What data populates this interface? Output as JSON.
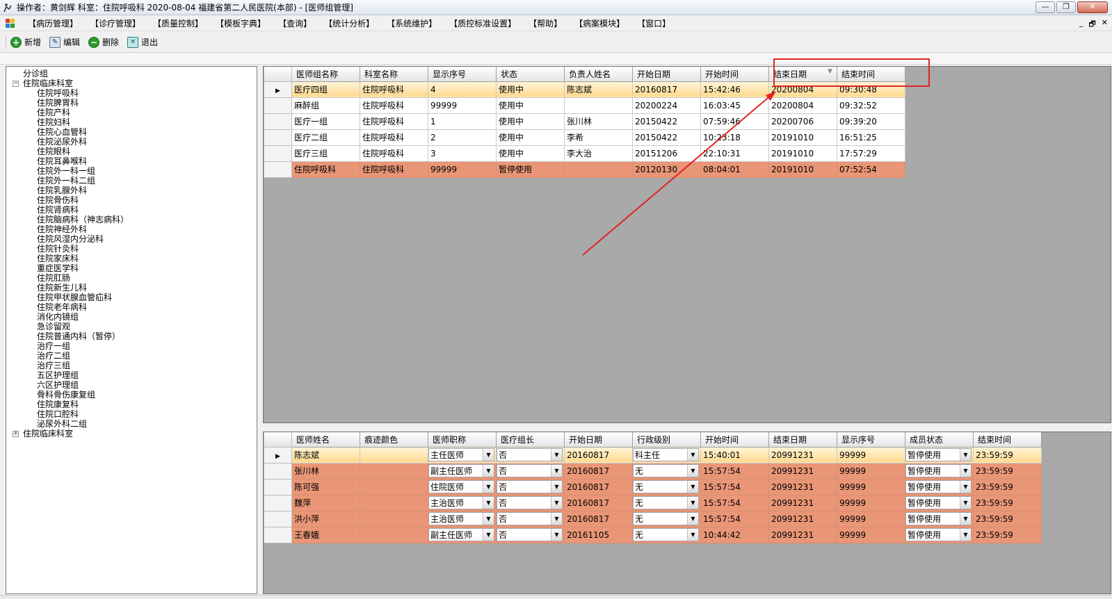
{
  "window": {
    "title": "操作者：黄剑辉  科室：住院呼吸科   2020-08-04   福建省第二人民医院(本部) - [医师组管理]",
    "minimize_glyph": "—",
    "restore_glyph": "❐",
    "close_glyph": "✕"
  },
  "menu": {
    "items": [
      "【病历管理】",
      "【诊疗管理】",
      "【质量控制】",
      "【模板字典】",
      "【查询】",
      "【统计分析】",
      "【系统维护】",
      "【质控标准设置】",
      "【帮助】",
      "【病案模块】",
      "【窗口】"
    ],
    "mdi_minimize": "_",
    "mdi_restore": "🗗",
    "mdi_close": "✕"
  },
  "toolbar": {
    "add_label": "新增",
    "edit_label": "编辑",
    "delete_label": "删除",
    "exit_label": "退出"
  },
  "tree": {
    "top_item": "分诊组",
    "group1": "住院临床科室",
    "children": [
      "住院呼吸科",
      "住院脾胃科",
      "住院产科",
      "住院妇科",
      "住院心血管科",
      "住院泌尿外科",
      "住院眼科",
      "住院耳鼻喉科",
      "住院外一科一组",
      "住院外一科二组",
      "住院乳腺外科",
      "住院骨伤科",
      "住院肾病科",
      "住院脑病科（神志病科）",
      "住院神经外科",
      "住院风湿内分泌科",
      "住院针灸科",
      "住院家床科",
      "重症医学科",
      "住院肛肠",
      "住院新生儿科",
      "住院甲状腺血管疝科",
      "住院老年病科",
      "消化内镜组",
      "急诊留观",
      "住院普通内科（暂停）",
      "治疗一组",
      "治疗二组",
      "治疗三组",
      "五区护理组",
      "六区护理组",
      "骨科骨伤康复组",
      "住院康复科",
      "住院口腔科",
      "泌尿外科二组"
    ],
    "group2": "住院临床科室"
  },
  "top_grid": {
    "columns": [
      "医师组名称",
      "科室名称",
      "显示序号",
      "状态",
      "负责人姓名",
      "开始日期",
      "开始时间",
      "结束日期",
      "结束时间"
    ],
    "rows": [
      [
        "医疗四组",
        "住院呼吸科",
        "4",
        "使用中",
        "陈志斌",
        "20160817",
        "15:42:46",
        "20200804",
        "09:30:48"
      ],
      [
        "麻醉组",
        "住院呼吸科",
        "99999",
        "使用中",
        "",
        "20200224",
        "16:03:45",
        "20200804",
        "09:32:52"
      ],
      [
        "医疗一组",
        "住院呼吸科",
        "1",
        "使用中",
        "张川林",
        "20150422",
        "07:59:46",
        "20200706",
        "09:39:20"
      ],
      [
        "医疗二组",
        "住院呼吸科",
        "2",
        "使用中",
        "李希",
        "20150422",
        "10:23:18",
        "20191010",
        "16:51:25"
      ],
      [
        "医疗三组",
        "住院呼吸科",
        "3",
        "使用中",
        "李大治",
        "20151206",
        "22:10:31",
        "20191010",
        "17:57:29"
      ],
      [
        "住院呼吸科",
        "住院呼吸科",
        "99999",
        "暂停使用",
        "",
        "20120130",
        "08:04:01",
        "20191010",
        "07:52:54"
      ]
    ],
    "sort_indicator": "▼"
  },
  "bottom_grid": {
    "columns": [
      "医师姓名",
      "痕迹颜色",
      "医师职称",
      "医疗组长",
      "开始日期",
      "行政级别",
      "开始时间",
      "结束日期",
      "显示序号",
      "成员状态",
      "结束时间"
    ],
    "rows": [
      [
        "陈志斌",
        "",
        "主任医师",
        "否",
        "20160817",
        "科主任",
        "15:40:01",
        "20991231",
        "99999",
        "暂停使用",
        "23:59:59"
      ],
      [
        "张川林",
        "",
        "副主任医师",
        "否",
        "20160817",
        "无",
        "15:57:54",
        "20991231",
        "99999",
        "暂停使用",
        "23:59:59"
      ],
      [
        "陈可强",
        "",
        "住院医师",
        "否",
        "20160817",
        "无",
        "15:57:54",
        "20991231",
        "99999",
        "暂停使用",
        "23:59:59"
      ],
      [
        "魏萍",
        "",
        "主治医师",
        "否",
        "20160817",
        "无",
        "15:57:54",
        "20991231",
        "99999",
        "暂停使用",
        "23:59:59"
      ],
      [
        "洪小萍",
        "",
        "主治医师",
        "否",
        "20160817",
        "无",
        "15:57:54",
        "20991231",
        "99999",
        "暂停使用",
        "23:59:59"
      ],
      [
        "王春娥",
        "",
        "副主任医师",
        "否",
        "20161105",
        "无",
        "10:44:42",
        "20991231",
        "99999",
        "暂停使用",
        "23:59:59"
      ]
    ],
    "combo_arrow": "▼"
  },
  "row_marker": "▶",
  "colors": {
    "selected_row": "#ffd98e",
    "paused_row": "#e99677",
    "grid_background": "#a9a9a9",
    "annotation": "#e02424"
  }
}
